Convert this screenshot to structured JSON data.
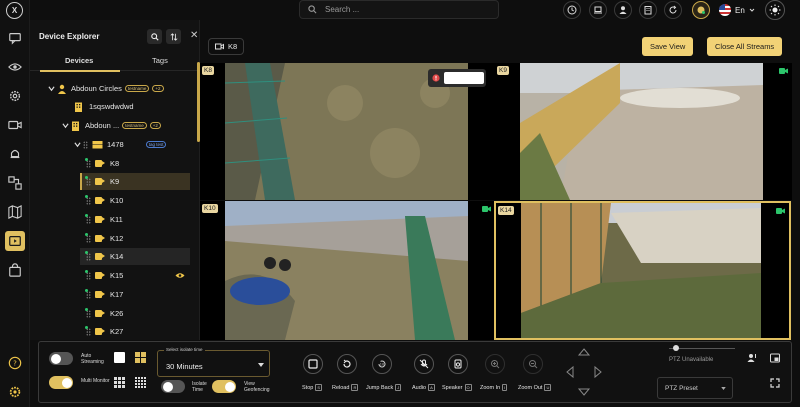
{
  "app": {
    "logo_text": "X"
  },
  "topbar": {
    "search_placeholder": "Search ...",
    "language": "En"
  },
  "explorer": {
    "title": "Device Explorer",
    "tabs": [
      {
        "label": "Devices"
      },
      {
        "label": "Tags"
      }
    ],
    "tree": [
      {
        "label": "Abdoun Circles",
        "tag": "testname",
        "count": "+2"
      },
      {
        "label": "1sqswdwdwd"
      },
      {
        "label": "Abdoun ...",
        "tag": "testname",
        "count": "+2"
      },
      {
        "label": "1478",
        "tag": "tag test"
      },
      {
        "label": "K8"
      },
      {
        "label": "K9"
      },
      {
        "label": "K10"
      },
      {
        "label": "K11"
      },
      {
        "label": "K12"
      },
      {
        "label": "K14"
      },
      {
        "label": "K15"
      },
      {
        "label": "K17"
      },
      {
        "label": "K26"
      },
      {
        "label": "K27"
      }
    ]
  },
  "viewer": {
    "current_chip": "K8",
    "save_view": "Save View",
    "close_all": "Close All Streams",
    "tiles": [
      {
        "label": "K8"
      },
      {
        "label": "K9"
      },
      {
        "label": "K10"
      },
      {
        "label": "K14"
      }
    ]
  },
  "controls": {
    "auto_streaming": "Auto Streaming",
    "multi_monitor": "Multi Monitor",
    "isolate_time": "Isolate Time",
    "view_geofencing": "View Geofencing",
    "isolate_caption": "Select isolate time",
    "isolate_value": "30 Minutes",
    "buttons": [
      {
        "label": "Stop",
        "key": "S"
      },
      {
        "label": "Reload",
        "key": "R"
      },
      {
        "label": "Jump Back",
        "key": "J"
      },
      {
        "label": "Audio",
        "key": "A"
      },
      {
        "label": "Speaker",
        "key": "O"
      },
      {
        "label": "Zoom In",
        "key": "I"
      },
      {
        "label": "Zoom Out",
        "key": "U"
      }
    ],
    "ptz_unavailable": "PTZ Unavailable",
    "ptz_preset": "PTZ Preset"
  },
  "colors": {
    "accent": "#e0c060",
    "live": "#2cc56b"
  }
}
